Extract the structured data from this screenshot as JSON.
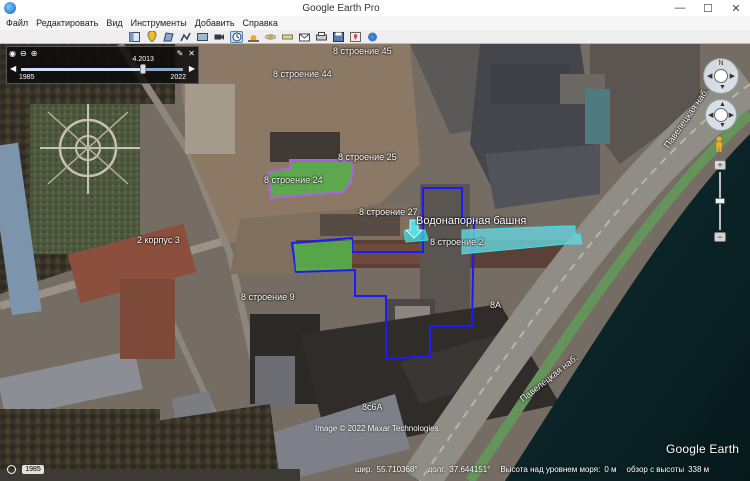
{
  "window": {
    "title": "Google Earth Pro",
    "minimize": "—",
    "maximize": "☐",
    "close": "✕"
  },
  "menu": [
    "Файл",
    "Редактировать",
    "Вид",
    "Инструменты",
    "Добавить",
    "Справка"
  ],
  "toolbar_icons": [
    "sidebar-toggle",
    "placemark",
    "polygon",
    "path",
    "image-overlay",
    "tour",
    "history",
    "sun",
    "planets",
    "ruler",
    "email",
    "print",
    "save-image",
    "maps",
    "earth"
  ],
  "time_slider": {
    "current": "4.2013",
    "min_year": "1985",
    "max_year": "2022",
    "position": 0.75
  },
  "labels": {
    "b45": "8 строение 45",
    "b44": "8 строение 44",
    "b25": "8 строение 25",
    "b24": "8 строение 24",
    "b27": "8 строение 27",
    "tower": "Водонапорная башня",
    "b2": "8 строение 2",
    "korpus3": "2 корпус 3",
    "b9": "8 строение 9",
    "b8a": "8А",
    "b8c6a": "8с6А",
    "street1": "Павелецкая наб.",
    "street2": "Павелецкая наб."
  },
  "copyright": "Image © 2022 Maxar Technologies",
  "logo": "Google Earth",
  "year_badge": "1985",
  "status": {
    "lat_label": "шир.",
    "lat": "55.710368°",
    "lon_label": "долг.",
    "lon": "37.644151°",
    "elev_label": "Высота над уровнем моря:",
    "elev": "0 м",
    "eye_label": "обзор с высоты",
    "eye": "338 м"
  },
  "nav": {
    "north": "N",
    "zoom_in": "+",
    "zoom_out": "−"
  },
  "colors": {
    "blue_outline": "#1a1aff",
    "purple_outline": "#b060e0",
    "cyan_outline": "#3ae0e8",
    "green_fill": "#55b04a",
    "cyan_fill": "#66d4dd"
  }
}
